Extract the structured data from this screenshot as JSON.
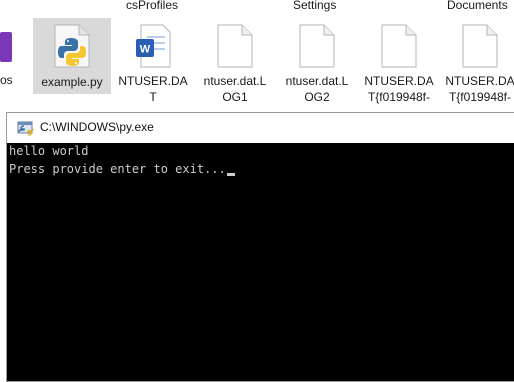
{
  "explorer": {
    "top_labels": [
      "csProfiles",
      "Settings",
      "Documents"
    ],
    "partial_left_label": "os",
    "files": [
      {
        "name": "example.py",
        "icon": "python-file-icon",
        "selected": true
      },
      {
        "name": "NTUSER.DA\nT",
        "icon": "word-document-icon",
        "selected": false
      },
      {
        "name": "ntuser.dat.L\nOG1",
        "icon": "blank-file-icon",
        "selected": false
      },
      {
        "name": "ntuser.dat.L\nOG2",
        "icon": "blank-file-icon",
        "selected": false
      },
      {
        "name": "NTUSER.DA\nT{f019948f-",
        "icon": "blank-file-icon",
        "selected": false
      },
      {
        "name": "NTUSER.DA\nT{f019948f-",
        "icon": "blank-file-icon",
        "selected": false
      }
    ]
  },
  "console": {
    "title": "C:\\WINDOWS\\py.exe",
    "lines": [
      "hello world",
      "Press provide enter to exit..."
    ]
  },
  "colors": {
    "console_bg": "#000000",
    "console_text": "#cccccc",
    "selection": "#d9d9d9"
  }
}
